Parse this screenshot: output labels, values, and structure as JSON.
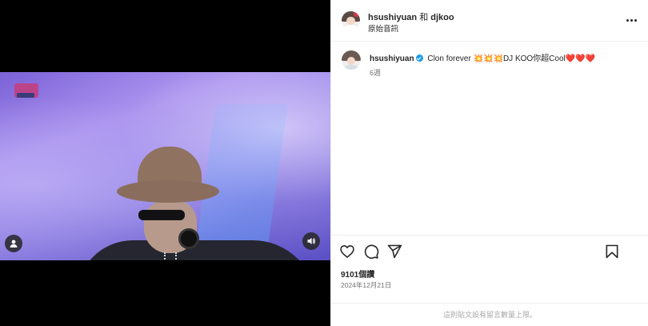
{
  "media": {
    "icons": {
      "user_tag": "person-icon",
      "mute": "speaker-icon"
    }
  },
  "header": {
    "author": "hsushiyuan",
    "joiner": "和",
    "collaborator": "djkoo",
    "subtitle": "原始音訊",
    "more_icon": "more-horizontal-icon"
  },
  "caption": {
    "username": "hsushiyuan",
    "text": "Clon forever 💥💥💥DJ KOO你超Cool❤️❤️❤️",
    "time": "6週"
  },
  "actions": {
    "icons": [
      "heart-icon",
      "comment-icon",
      "share-icon",
      "bookmark-icon"
    ]
  },
  "likes": "9101個讚",
  "date": "2024年12月21日",
  "comments_notice": "這則貼文設有留言數量上限。",
  "colors": {
    "verified": "#1d9bf0",
    "text_primary": "#262626",
    "text_secondary": "#737373",
    "divider": "#efefef"
  }
}
